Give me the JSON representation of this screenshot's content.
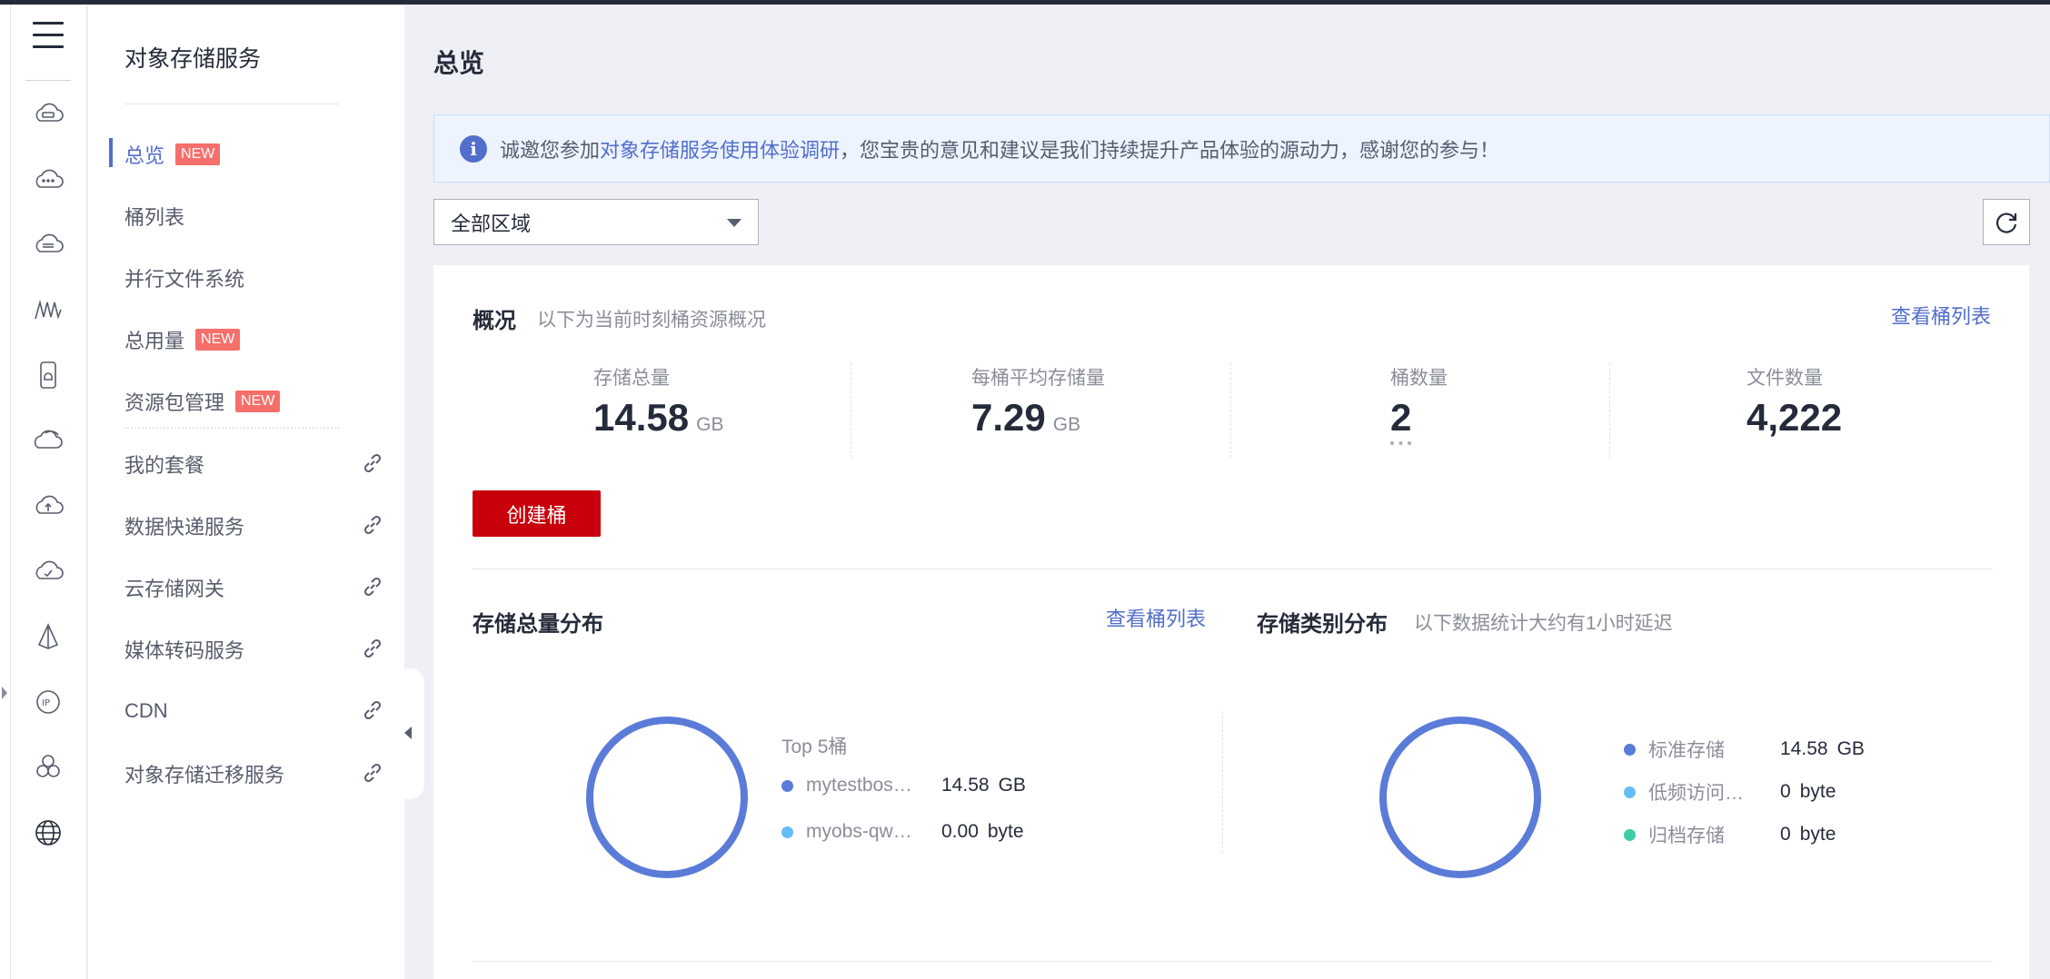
{
  "rail": {
    "icons": [
      "cloud-server-icon",
      "cloud-chat-icon",
      "cloud-storage-icon",
      "waveform-icon",
      "mobile-device-icon",
      "cloud-sync-icon",
      "cloud-upload-icon",
      "cloud-check-icon",
      "pyramid-icon",
      "ip-icon",
      "cluster-icon",
      "globe-web-icon"
    ]
  },
  "subnav": {
    "title": "对象存储服务",
    "items": [
      {
        "label": "总览",
        "badge": "NEW"
      },
      {
        "label": "桶列表"
      },
      {
        "label": "并行文件系统"
      },
      {
        "label": "总用量",
        "badge": "NEW"
      },
      {
        "label": "资源包管理",
        "badge": "NEW"
      },
      {
        "label": "我的套餐"
      },
      {
        "label": "数据快递服务"
      },
      {
        "label": "云存储网关"
      },
      {
        "label": "媒体转码服务"
      },
      {
        "label": "CDN"
      },
      {
        "label": "对象存储迁移服务"
      }
    ]
  },
  "page": {
    "title": "总览",
    "notice": {
      "prefix": "诚邀您参加",
      "link": "对象存储服务使用体验调研",
      "suffix": "，您宝贵的意见和建议是我们持续提升产品体验的源动力，感谢您的参与！"
    },
    "region": "全部区域"
  },
  "overview": {
    "title": "概况",
    "subtitle": "以下为当前时刻桶资源概况",
    "link": "查看桶列表",
    "stats": [
      {
        "label": "存储总量",
        "value": "14.58",
        "unit": "GB"
      },
      {
        "label": "每桶平均存储量",
        "value": "7.29",
        "unit": "GB"
      },
      {
        "label": "桶数量",
        "value": "2",
        "unit": ""
      },
      {
        "label": "文件数量",
        "value": "4,222",
        "unit": ""
      }
    ],
    "create_button": "创建桶"
  },
  "storage_dist": {
    "title": "存储总量分布",
    "link": "查看桶列表",
    "top_label": "Top 5桶",
    "items": [
      {
        "name": "mytestbos…",
        "value": "14.58",
        "unit": "GB",
        "color": "#5b7bd8"
      },
      {
        "name": "myobs-qw…",
        "value": "0.00",
        "unit": "byte",
        "color": "#65bdf5"
      }
    ]
  },
  "class_dist": {
    "title": "存储类别分布",
    "subtitle": "以下数据统计大约有1小时延迟",
    "items": [
      {
        "name": "标准存储",
        "value": "14.58",
        "unit": "GB",
        "color": "#5b7bd8"
      },
      {
        "name": "低频访问…",
        "value": "0",
        "unit": "byte",
        "color": "#65bdf5"
      },
      {
        "name": "归档存储",
        "value": "0",
        "unit": "byte",
        "color": "#3dcca6"
      }
    ]
  },
  "colors": {
    "accent": "#526ecc",
    "primary_button": "#c7000b",
    "badge": "#f66f6a",
    "donut": "#5b7bd8"
  }
}
